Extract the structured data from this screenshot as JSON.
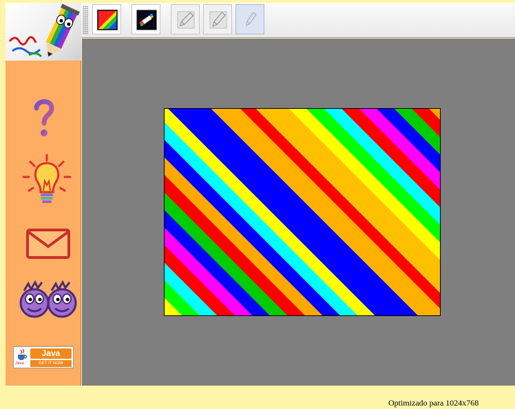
{
  "toolbar": {
    "buttons": [
      {
        "name": "colors",
        "state": "enabled",
        "icon": "rainbow-square-icon"
      },
      {
        "name": "brush-palette",
        "state": "enabled",
        "icon": "brush-on-dark-icon"
      },
      {
        "name": "pencil-1",
        "state": "disabled",
        "icon": "pencil-icon"
      },
      {
        "name": "pencil-2",
        "state": "disabled",
        "icon": "pencil-icon"
      },
      {
        "name": "pencil-3",
        "state": "pressed",
        "icon": "pencil-icon"
      }
    ]
  },
  "sidebar": {
    "items": [
      {
        "icon": "question-mark-icon"
      },
      {
        "icon": "lightbulb-icon"
      },
      {
        "icon": "envelope-icon"
      },
      {
        "icon": "faces-icon"
      }
    ],
    "java_badge": {
      "word": "Java",
      "tagline": "GET IT NOW",
      "small": "Java"
    }
  },
  "colors": {
    "page_background": "#fff5a8",
    "sidebar": "#ffad63",
    "canvas_area": "#7f7f7f",
    "stripes": [
      "#ffff00",
      "#00ff00",
      "#00ffff",
      "#ff0000",
      "#ff00ff",
      "#0000ff",
      "#ffa800"
    ]
  },
  "footer": {
    "text": "Optimizado para 1024x768"
  }
}
